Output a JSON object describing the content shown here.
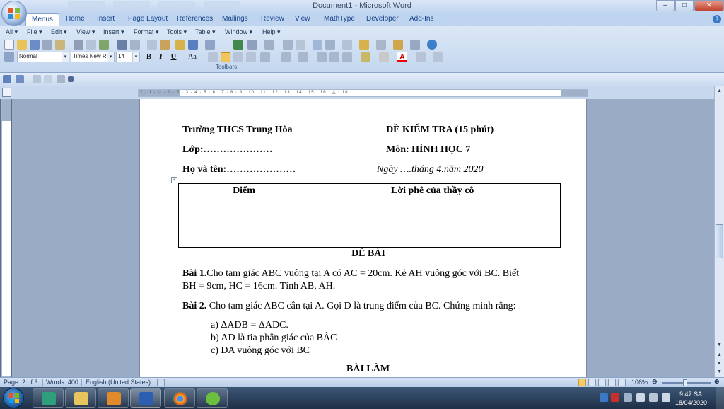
{
  "window": {
    "title": "Document1 - Microsoft Word",
    "buttons": {
      "minimize": "–",
      "maximize": "□",
      "close": "✕"
    }
  },
  "ribbon": {
    "tabs": [
      "Menus",
      "Home",
      "Insert",
      "Page Layout",
      "References",
      "Mailings",
      "Review",
      "View",
      "MathType",
      "Developer",
      "Add-Ins"
    ],
    "active_tab": "Menus",
    "menus": [
      "All ▾",
      "File ▾",
      "Edit ▾",
      "View ▾",
      "Insert ▾",
      "Format ▾",
      "Tools ▾",
      "Table ▾",
      "Window ▾",
      "Help ▾"
    ],
    "style_value": "Normal",
    "font_value": "Times New Ro",
    "size_value": "14",
    "format_buttons": {
      "bold": "B",
      "italic": "I",
      "underline": "U",
      "case": "Aa"
    },
    "group_label": "Toolbars"
  },
  "ruler": {
    "marks": "2 · 1 · ▽ · 1 · 2 · 3 · 4 · 5 · 6 · 7 · 8 · 9 · 10 · 11 · 12 · 13 · 14 · 15 · 16 · △ · 18 ·"
  },
  "document": {
    "school": "Trường THCS Trung Hòa",
    "test_title": "ĐỀ KIỂM  TRA (15 phút)",
    "class_label": "Lớp:…………………",
    "subject": "Môn: HÌNH HỌC 7",
    "name_label": "Họ và tên:…………………",
    "date": "Ngày ….tháng 4.năm 2020",
    "table_headers": [
      "Điểm",
      "Lời phê của thầy cô"
    ],
    "section_title": "ĐỀ BÀI",
    "q1_label": "Bài 1.",
    "q1_line1": "Cho tam giác ABC vuông tại A có AC = 20cm. Kẻ AH vuông góc với BC. Biết",
    "q1_line2": "BH = 9cm, HC = 16cm. Tính AB, AH.",
    "q2_label": "Bài 2.",
    "q2_text": " Cho tam giác ABC cân tại A. Gọi D là trung điểm của BC. Chứng minh rằng:",
    "q2_items": [
      "a)  ΔADB = ΔADC.",
      "b)  AD là tia phân giác của BÂC",
      "c)  DA vuông góc với BC"
    ],
    "answer_title": "BÀI LÀM"
  },
  "statusbar": {
    "page": "Page: 2 of 3",
    "words": "Words: 400",
    "language": "English (United States)",
    "zoom": "106%"
  },
  "taskbar": {
    "time": "9:47 SA",
    "date": "18/04/2020"
  },
  "colors": {
    "ribbon_bg": "#c4d7ef",
    "taskbar_bg": "#1e2f46",
    "doc_background": "#9aabc6"
  }
}
